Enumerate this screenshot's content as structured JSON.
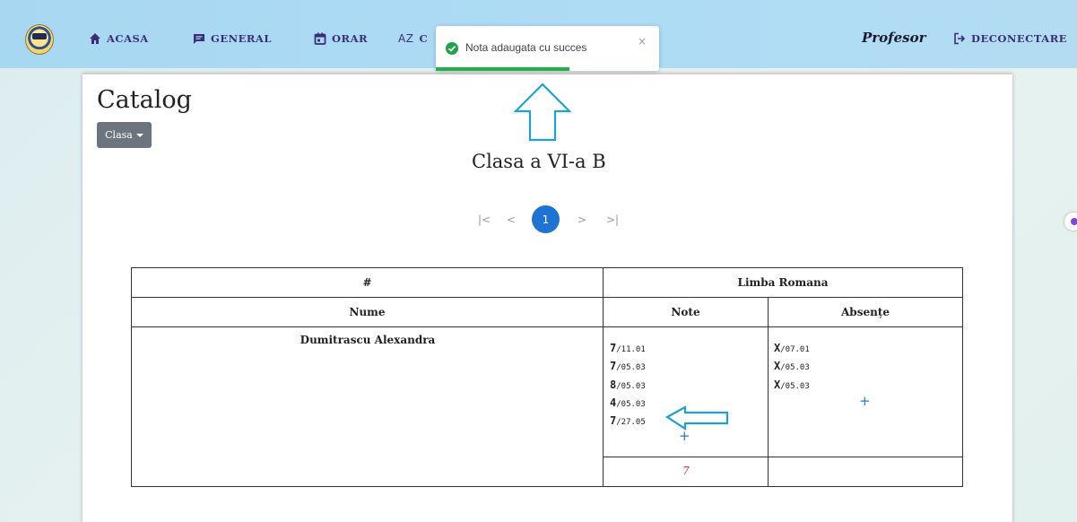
{
  "navbar": {
    "items": [
      {
        "label": "ACASA",
        "icon": "home-icon"
      },
      {
        "label": "GENERAL",
        "icon": "message-icon"
      },
      {
        "label": "ORAR",
        "icon": "calendar-icon"
      },
      {
        "label": "C",
        "icon": "sort-az-icon",
        "icon_text": "AZ"
      }
    ],
    "role": "Profesor",
    "logout_label": "DECONECTARE",
    "colors": {
      "background": "#a8d7f2",
      "text": "#3a2d7a"
    }
  },
  "toast": {
    "message": "Nota adaugata cu succes",
    "close": "×",
    "progress": 0.6,
    "colors": {
      "success": "#1fa24a"
    }
  },
  "page": {
    "title": "Catalog",
    "class_dropdown": "Clasa",
    "class_title": "Clasa a VI-a B"
  },
  "pagination": {
    "first": "|<",
    "prev": "<",
    "current": "1",
    "next": ">",
    "last": ">|",
    "active_color": "#1e74d4"
  },
  "table": {
    "header_index": "#",
    "subject": "Limba Romana",
    "col_name": "Nume",
    "col_grades": "Note",
    "col_absences": "Absențe",
    "rows": [
      {
        "student": "Dumitrascu Alexandra",
        "grades": [
          {
            "value": "7",
            "date": "/11.01"
          },
          {
            "value": "7",
            "date": "/05.03"
          },
          {
            "value": "8",
            "date": "/05.03"
          },
          {
            "value": "4",
            "date": "/05.03"
          },
          {
            "value": "7",
            "date": "/27.05"
          }
        ],
        "absences": [
          {
            "value": "X",
            "date": "/07.01"
          },
          {
            "value": "X",
            "date": "/05.03"
          },
          {
            "value": "X",
            "date": "/05.03"
          }
        ],
        "add_grade": "+",
        "add_absence": "+",
        "average": "7"
      }
    ]
  }
}
